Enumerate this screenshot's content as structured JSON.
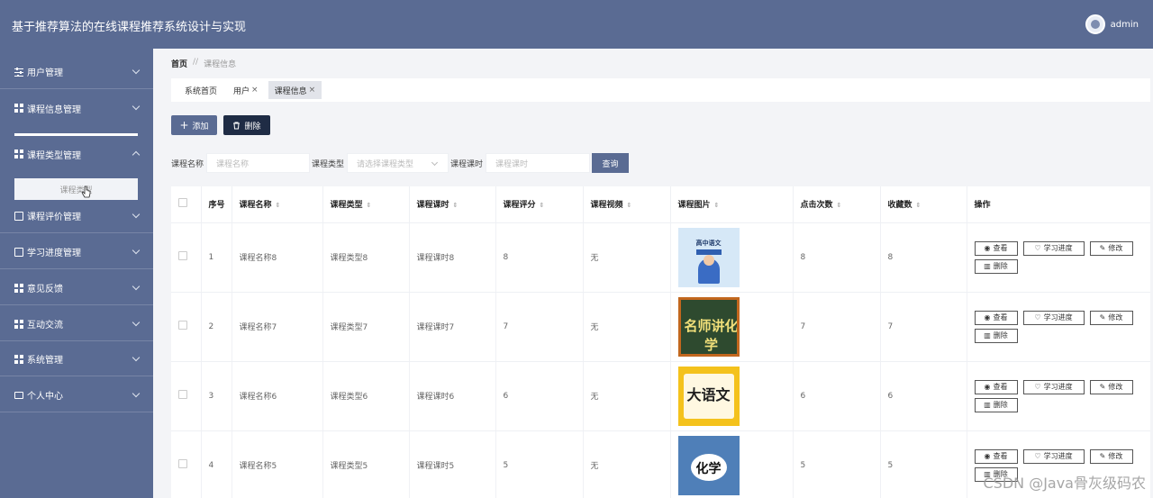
{
  "header": {
    "title": "基于推荐算法的在线课程推荐系统设计与实现",
    "username": "admin"
  },
  "sidebar": {
    "items": [
      {
        "label": "用户管理",
        "icon": "sliders-icon"
      },
      {
        "label": "课程信息管理",
        "icon": "grid-icon"
      },
      {
        "label": "课程类型管理",
        "icon": "grid-icon"
      },
      {
        "label": "课程评价管理",
        "icon": "clipboard-icon"
      },
      {
        "label": "学习进度管理",
        "icon": "checkbox-icon"
      },
      {
        "label": "意见反馈",
        "icon": "grid-icon"
      },
      {
        "label": "互动交流",
        "icon": "grid-icon"
      },
      {
        "label": "系统管理",
        "icon": "grid-icon"
      },
      {
        "label": "个人中心",
        "icon": "card-icon"
      }
    ],
    "submenu_label": "课程类型"
  },
  "breadcrumb": {
    "home": "首页",
    "separator": "//",
    "current": "课程信息"
  },
  "tabs": [
    {
      "label": "系统首页",
      "closable": false
    },
    {
      "label": "用户",
      "closable": true
    },
    {
      "label": "课程信息",
      "closable": true
    }
  ],
  "tab_close": "×",
  "toolbar": {
    "add_label": "添加",
    "delete_label": "删除"
  },
  "search": {
    "name_label": "课程名称",
    "name_placeholder": "课程名称",
    "type_label": "课程类型",
    "type_placeholder": "请选择课程类型",
    "hours_label": "课程课时",
    "hours_placeholder": "课程课时",
    "button": "查询"
  },
  "table": {
    "columns": [
      "序号",
      "课程名称",
      "课程类型",
      "课程课时",
      "课程评分",
      "课程视频",
      "课程图片",
      "点击次数",
      "收藏数",
      "操作"
    ],
    "rows": [
      {
        "index": "1",
        "name": "课程名称8",
        "type": "课程类型8",
        "hours": "课程课时8",
        "score": "8",
        "video": "无",
        "image_text": "高中语文",
        "clicks": "8",
        "favorites": "8"
      },
      {
        "index": "2",
        "name": "课程名称7",
        "type": "课程类型7",
        "hours": "课程课时7",
        "score": "7",
        "video": "无",
        "image_text": "名师讲化学",
        "clicks": "7",
        "favorites": "7"
      },
      {
        "index": "3",
        "name": "课程名称6",
        "type": "课程类型6",
        "hours": "课程课时6",
        "score": "6",
        "video": "无",
        "image_text": "大语文",
        "clicks": "6",
        "favorites": "6"
      },
      {
        "index": "4",
        "name": "课程名称5",
        "type": "课程类型5",
        "hours": "课程课时5",
        "score": "5",
        "video": "无",
        "image_text": "化学",
        "clicks": "5",
        "favorites": "5"
      }
    ],
    "actions": {
      "view": "查看",
      "progress": "学习进度",
      "edit": "修改",
      "delete": "删除"
    }
  },
  "watermark": "CSDN @Java骨灰级码农",
  "colors": {
    "primary": "#5a6b93",
    "dark_button": "#1f2c45",
    "background": "#f3f4f7"
  }
}
